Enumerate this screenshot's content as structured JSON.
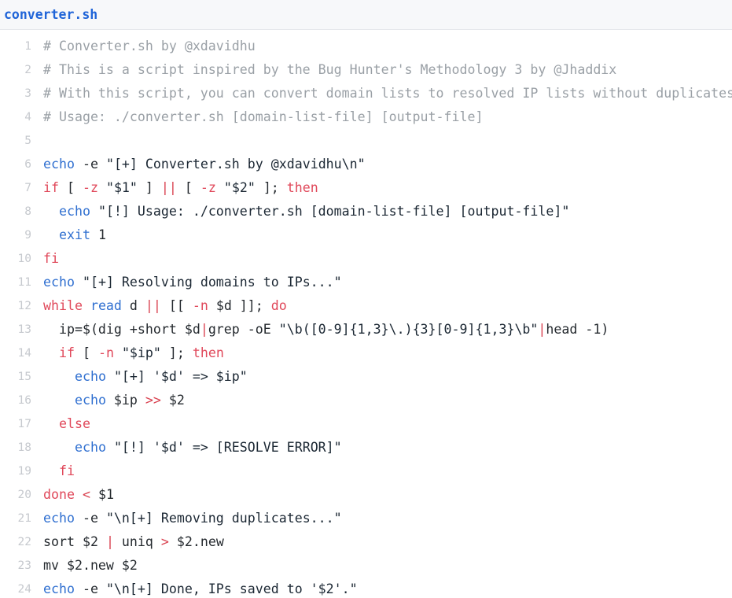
{
  "header": {
    "filename": "converter.sh"
  },
  "editor": {
    "language": "bash",
    "first_line_number": 1,
    "last_line_number": 24,
    "colors": {
      "header_background": "#f7f8fa",
      "header_border": "#e6e8ec",
      "title": "#1f64d8",
      "background": "#ffffff",
      "line_number": "#c6c9ce",
      "text": "#24292e",
      "comment": "#9aa0a6",
      "keyword": "#e0485a",
      "builtin": "#2f6fd0",
      "operator": "#d9414f",
      "string": "#1b2733"
    }
  },
  "code": {
    "lines": [
      {
        "number": "1",
        "text": "# Converter.sh by @xdavidhu",
        "tokens": [
          {
            "t": "# Converter.sh by @xdavidhu",
            "c": "tok-comment"
          }
        ]
      },
      {
        "number": "2",
        "text": "# This is a script inspired by the Bug Hunter's Methodology 3 by @Jhaddix",
        "tokens": [
          {
            "t": "# This is a script inspired by the Bug Hunter's Methodology 3 by @Jhaddix",
            "c": "tok-comment"
          }
        ]
      },
      {
        "number": "3",
        "text": "# With this script, you can convert domain lists to resolved IP lists without duplicates.",
        "tokens": [
          {
            "t": "# With this script, you can convert domain lists to resolved IP lists without duplicates.",
            "c": "tok-comment"
          }
        ]
      },
      {
        "number": "4",
        "text": "# Usage: ./converter.sh [domain-list-file] [output-file]",
        "tokens": [
          {
            "t": "# Usage: ./converter.sh [domain-list-file] [output-file]",
            "c": "tok-comment"
          }
        ]
      },
      {
        "number": "5",
        "text": "",
        "tokens": []
      },
      {
        "number": "6",
        "text": "echo -e \"[+] Converter.sh by @xdavidhu\\n\"",
        "tokens": [
          {
            "t": "echo",
            "c": "tok-builtin"
          },
          {
            "t": " ",
            "c": "tok-plain"
          },
          {
            "t": "-e",
            "c": "tok-plain"
          },
          {
            "t": " ",
            "c": "tok-plain"
          },
          {
            "t": "\"[+] Converter.sh by @xdavidhu\\n\"",
            "c": "tok-string"
          }
        ]
      },
      {
        "number": "7",
        "text": "if [ -z \"$1\" ] || [ -z \"$2\" ]; then",
        "tokens": [
          {
            "t": "if",
            "c": "tok-keyword"
          },
          {
            "t": " [ ",
            "c": "tok-plain"
          },
          {
            "t": "-z",
            "c": "tok-flag"
          },
          {
            "t": " ",
            "c": "tok-plain"
          },
          {
            "t": "\"$1\"",
            "c": "tok-string"
          },
          {
            "t": " ] ",
            "c": "tok-plain"
          },
          {
            "t": "||",
            "c": "tok-op"
          },
          {
            "t": " [ ",
            "c": "tok-plain"
          },
          {
            "t": "-z",
            "c": "tok-flag"
          },
          {
            "t": " ",
            "c": "tok-plain"
          },
          {
            "t": "\"$2\"",
            "c": "tok-string"
          },
          {
            "t": " ]; ",
            "c": "tok-plain"
          },
          {
            "t": "then",
            "c": "tok-keyword"
          }
        ]
      },
      {
        "number": "8",
        "text": "  echo \"[!] Usage: ./converter.sh [domain-list-file] [output-file]\"",
        "tokens": [
          {
            "t": "  ",
            "c": "tok-plain"
          },
          {
            "t": "echo",
            "c": "tok-builtin"
          },
          {
            "t": " ",
            "c": "tok-plain"
          },
          {
            "t": "\"[!] Usage: ./converter.sh [domain-list-file] [output-file]\"",
            "c": "tok-string"
          }
        ]
      },
      {
        "number": "9",
        "text": "  exit 1",
        "tokens": [
          {
            "t": "  ",
            "c": "tok-plain"
          },
          {
            "t": "exit",
            "c": "tok-builtin"
          },
          {
            "t": " ",
            "c": "tok-plain"
          },
          {
            "t": "1",
            "c": "tok-number"
          }
        ]
      },
      {
        "number": "10",
        "text": "fi",
        "tokens": [
          {
            "t": "fi",
            "c": "tok-keyword"
          }
        ]
      },
      {
        "number": "11",
        "text": "echo \"[+] Resolving domains to IPs...\"",
        "tokens": [
          {
            "t": "echo",
            "c": "tok-builtin"
          },
          {
            "t": " ",
            "c": "tok-plain"
          },
          {
            "t": "\"[+] Resolving domains to IPs...\"",
            "c": "tok-string"
          }
        ]
      },
      {
        "number": "12",
        "text": "while read d || [[ -n $d ]]; do",
        "tokens": [
          {
            "t": "while",
            "c": "tok-keyword"
          },
          {
            "t": " ",
            "c": "tok-plain"
          },
          {
            "t": "read",
            "c": "tok-builtin"
          },
          {
            "t": " d ",
            "c": "tok-plain"
          },
          {
            "t": "||",
            "c": "tok-op"
          },
          {
            "t": " [[ ",
            "c": "tok-plain"
          },
          {
            "t": "-n",
            "c": "tok-flag"
          },
          {
            "t": " $d ]]; ",
            "c": "tok-plain"
          },
          {
            "t": "do",
            "c": "tok-keyword"
          }
        ]
      },
      {
        "number": "13",
        "text": "  ip=$(dig +short $d|grep -oE \"\\b([0-9]{1,3}\\.){3}[0-9]{1,3}\\b\"|head -1)",
        "tokens": [
          {
            "t": "  ip=$(dig +short $d",
            "c": "tok-plain"
          },
          {
            "t": "|",
            "c": "tok-op"
          },
          {
            "t": "grep -oE ",
            "c": "tok-plain"
          },
          {
            "t": "\"\\b([0-9]{1,3}\\.){3}[0-9]{1,3}\\b\"",
            "c": "tok-string"
          },
          {
            "t": "|",
            "c": "tok-op"
          },
          {
            "t": "head -1)",
            "c": "tok-plain"
          }
        ]
      },
      {
        "number": "14",
        "text": "  if [ -n \"$ip\" ]; then",
        "tokens": [
          {
            "t": "  ",
            "c": "tok-plain"
          },
          {
            "t": "if",
            "c": "tok-keyword"
          },
          {
            "t": " [ ",
            "c": "tok-plain"
          },
          {
            "t": "-n",
            "c": "tok-flag"
          },
          {
            "t": " ",
            "c": "tok-plain"
          },
          {
            "t": "\"$ip\"",
            "c": "tok-string"
          },
          {
            "t": " ]; ",
            "c": "tok-plain"
          },
          {
            "t": "then",
            "c": "tok-keyword"
          }
        ]
      },
      {
        "number": "15",
        "text": "    echo \"[+] '$d' => $ip\"",
        "tokens": [
          {
            "t": "    ",
            "c": "tok-plain"
          },
          {
            "t": "echo",
            "c": "tok-builtin"
          },
          {
            "t": " ",
            "c": "tok-plain"
          },
          {
            "t": "\"[+] '$d' => $ip\"",
            "c": "tok-string"
          }
        ]
      },
      {
        "number": "16",
        "text": "    echo $ip >> $2",
        "tokens": [
          {
            "t": "    ",
            "c": "tok-plain"
          },
          {
            "t": "echo",
            "c": "tok-builtin"
          },
          {
            "t": " $ip ",
            "c": "tok-plain"
          },
          {
            "t": ">>",
            "c": "tok-op"
          },
          {
            "t": " $2",
            "c": "tok-plain"
          }
        ]
      },
      {
        "number": "17",
        "text": "  else",
        "tokens": [
          {
            "t": "  ",
            "c": "tok-plain"
          },
          {
            "t": "else",
            "c": "tok-keyword"
          }
        ]
      },
      {
        "number": "18",
        "text": "    echo \"[!] '$d' => [RESOLVE ERROR]\"",
        "tokens": [
          {
            "t": "    ",
            "c": "tok-plain"
          },
          {
            "t": "echo",
            "c": "tok-builtin"
          },
          {
            "t": " ",
            "c": "tok-plain"
          },
          {
            "t": "\"[!] '$d' => [RESOLVE ERROR]\"",
            "c": "tok-string"
          }
        ]
      },
      {
        "number": "19",
        "text": "  fi",
        "tokens": [
          {
            "t": "  ",
            "c": "tok-plain"
          },
          {
            "t": "fi",
            "c": "tok-keyword"
          }
        ]
      },
      {
        "number": "20",
        "text": "done < $1",
        "tokens": [
          {
            "t": "done",
            "c": "tok-keyword"
          },
          {
            "t": " ",
            "c": "tok-plain"
          },
          {
            "t": "<",
            "c": "tok-op"
          },
          {
            "t": " $1",
            "c": "tok-plain"
          }
        ]
      },
      {
        "number": "21",
        "text": "echo -e \"\\n[+] Removing duplicates...\"",
        "tokens": [
          {
            "t": "echo",
            "c": "tok-builtin"
          },
          {
            "t": " -e ",
            "c": "tok-plain"
          },
          {
            "t": "\"\\n[+] Removing duplicates...\"",
            "c": "tok-string"
          }
        ]
      },
      {
        "number": "22",
        "text": "sort $2 | uniq > $2.new",
        "tokens": [
          {
            "t": "sort $2 ",
            "c": "tok-plain"
          },
          {
            "t": "|",
            "c": "tok-op"
          },
          {
            "t": " uniq ",
            "c": "tok-plain"
          },
          {
            "t": ">",
            "c": "tok-op"
          },
          {
            "t": " $2.new",
            "c": "tok-plain"
          }
        ]
      },
      {
        "number": "23",
        "text": "mv $2.new $2",
        "tokens": [
          {
            "t": "mv $2.new $2",
            "c": "tok-plain"
          }
        ]
      },
      {
        "number": "24",
        "text": "echo -e \"\\n[+] Done, IPs saved to '$2'.\"",
        "tokens": [
          {
            "t": "echo",
            "c": "tok-builtin"
          },
          {
            "t": " -e ",
            "c": "tok-plain"
          },
          {
            "t": "\"\\n[+] Done, IPs saved to '$2'.\"",
            "c": "tok-string"
          }
        ]
      }
    ]
  }
}
